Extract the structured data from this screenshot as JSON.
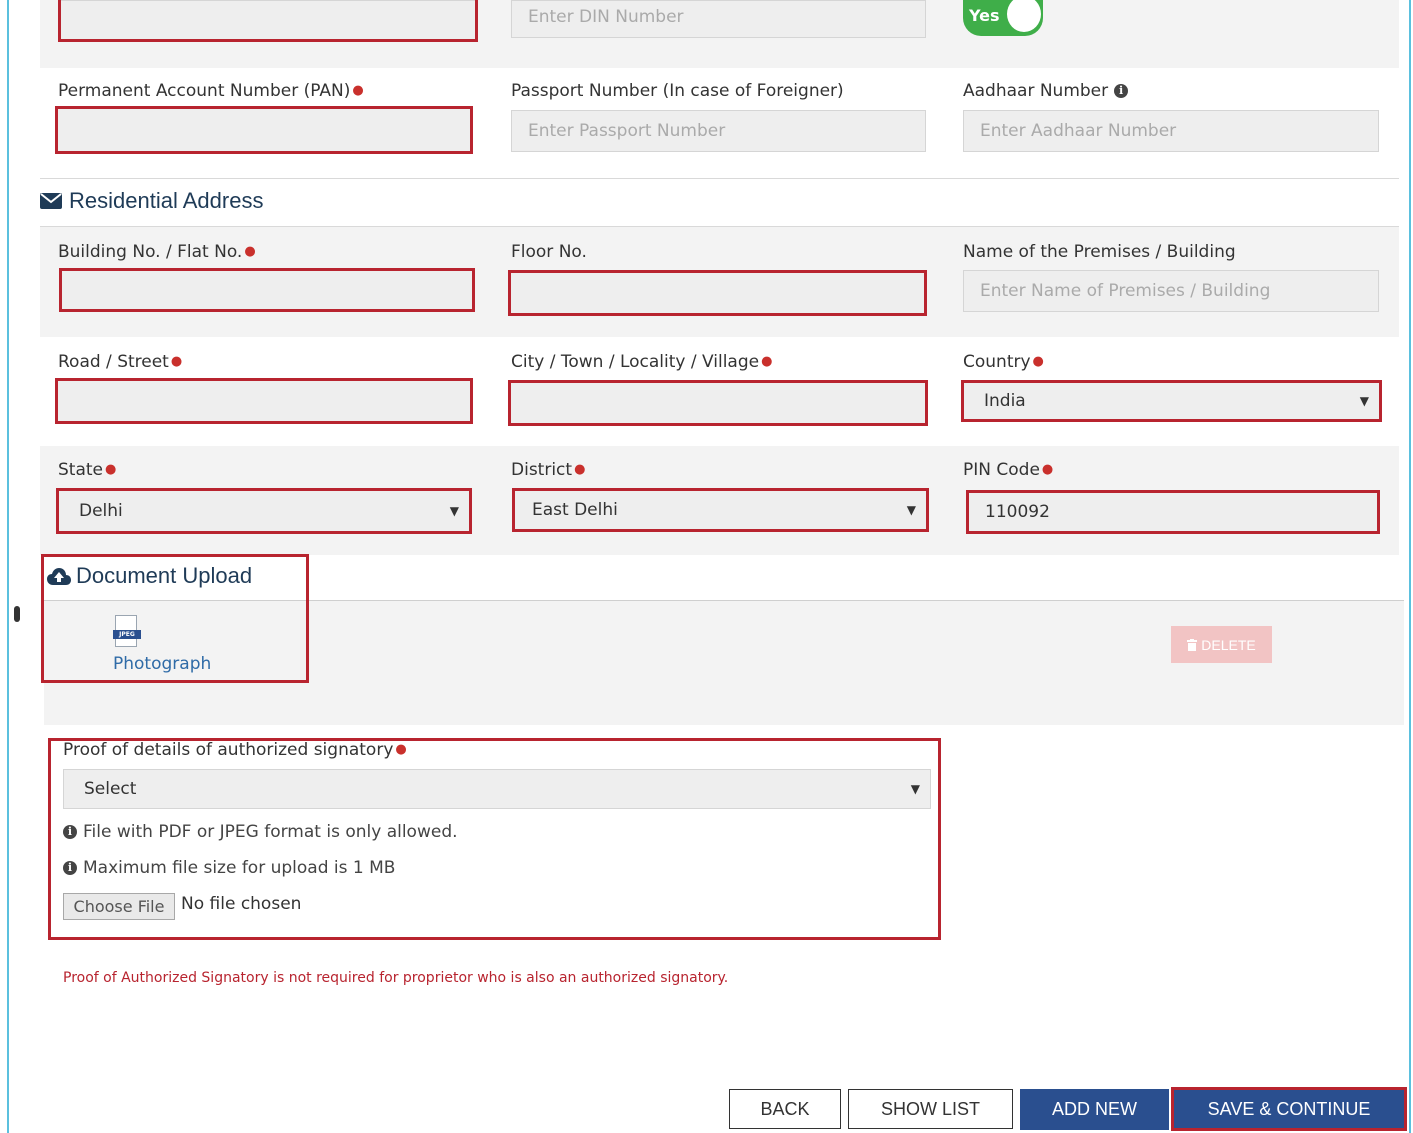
{
  "top_row": {
    "din_placeholder": "Enter DIN Number",
    "toggle_label": "Yes"
  },
  "identity": {
    "pan_label": "Permanent Account Number (PAN)",
    "pan_value": "",
    "passport_label": "Passport Number (In case of Foreigner)",
    "passport_placeholder": "Enter Passport Number",
    "aadhaar_label": "Aadhaar Number",
    "aadhaar_placeholder": "Enter Aadhaar Number"
  },
  "residential_address": {
    "title": "Residential Address",
    "building_label": "Building No. / Flat No.",
    "floor_label": "Floor No.",
    "premises_label": "Name of the Premises / Building",
    "premises_placeholder": "Enter Name of Premises / Building",
    "road_label": "Road / Street",
    "city_label": "City / Town / Locality / Village",
    "country_label": "Country",
    "country_value": "India",
    "state_label": "State",
    "state_value": "Delhi",
    "district_label": "District",
    "district_value": "East Delhi",
    "pin_label": "PIN Code",
    "pin_value": "110092"
  },
  "document_upload": {
    "title": "Document Upload",
    "file_badge": "JPEG",
    "photograph_link": "Photograph",
    "delete_label": "DELETE"
  },
  "proof": {
    "label": "Proof of details of authorized signatory",
    "select_value": "Select",
    "info_format": "File with PDF or JPEG format is only allowed.",
    "info_size": "Maximum file size for upload is 1 MB",
    "choose_file_label": "Choose File",
    "no_file_text": "No file chosen",
    "note": "Proof of Authorized Signatory is not required for proprietor who is also an authorized signatory."
  },
  "actions": {
    "back": "BACK",
    "show_list": "SHOW LIST",
    "add_new": "ADD NEW",
    "save_continue": "SAVE & CONTINUE"
  },
  "colors": {
    "highlight": "#b8242f",
    "primary": "#2a4f8f",
    "toggle_green": "#3fae49",
    "section_title": "#1f3b57",
    "link": "#2f6ba7",
    "note_red": "#b8242f"
  },
  "icons": {
    "residential": "envelope-icon",
    "document": "cloud-upload-icon",
    "aadhaar_info": "info-circle-icon",
    "delete": "trash-icon"
  }
}
